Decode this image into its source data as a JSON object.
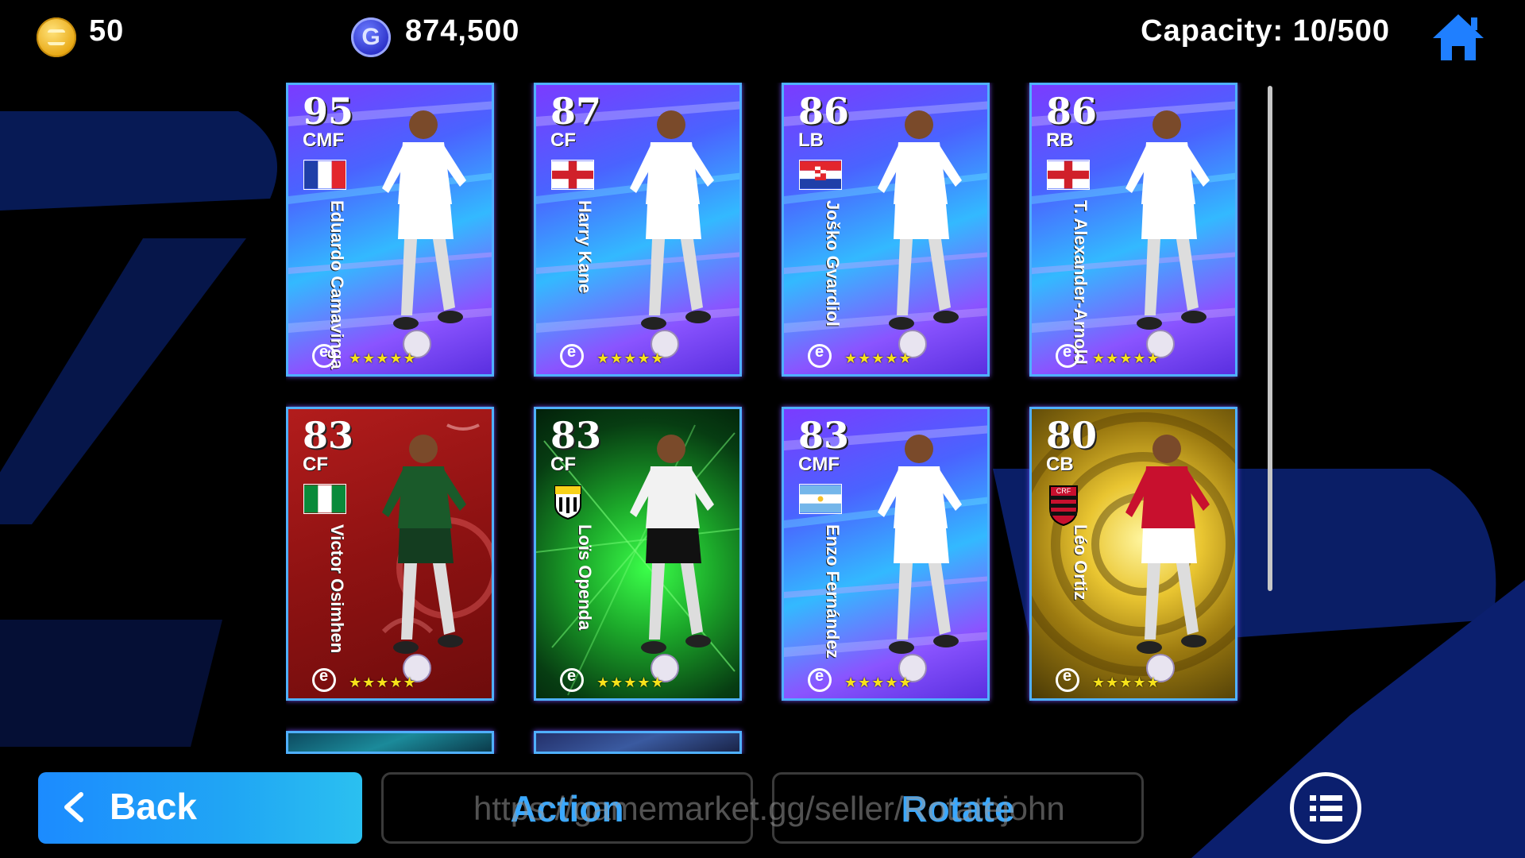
{
  "currency": {
    "coins": "50",
    "gp": "874,500",
    "gp_symbol": "G"
  },
  "capacity": "Capacity: 10/500",
  "cards": [
    {
      "rating": "95",
      "position": "CMF",
      "name": "Eduardo Camavinga",
      "flag": "france",
      "style": "blue",
      "stars": "★★★★★"
    },
    {
      "rating": "87",
      "position": "CF",
      "name": "Harry Kane",
      "flag": "england",
      "style": "blue",
      "stars": "★★★★★"
    },
    {
      "rating": "86",
      "position": "LB",
      "name": "Joško Gvardiol",
      "flag": "croatia",
      "style": "blue",
      "stars": "★★★★★"
    },
    {
      "rating": "86",
      "position": "RB",
      "name": "T. Alexander-Arnold",
      "flag": "england",
      "style": "blue",
      "stars": "★★★★★"
    },
    {
      "rating": "83",
      "position": "CF",
      "name": "Victor Osimhen",
      "flag": "nigeria",
      "style": "red",
      "stars": "★★★★★"
    },
    {
      "rating": "83",
      "position": "CF",
      "name": "Loïs Openda",
      "flag": "club-yellow-black",
      "style": "green",
      "stars": "★★★★★"
    },
    {
      "rating": "83",
      "position": "CMF",
      "name": "Enzo Fernández",
      "flag": "argentina",
      "style": "blue",
      "stars": "★★★★★"
    },
    {
      "rating": "80",
      "position": "CB",
      "name": "Léo Ortiz",
      "flag": "flamengo-crest",
      "style": "gold",
      "stars": "★★★★★"
    }
  ],
  "buttons": {
    "back": "Back",
    "action": "Action",
    "rotate": "Rotate"
  },
  "watermark": "https://gamemarket.gg/seller/Rotatejohn",
  "icons": {
    "coin": "coin-icon",
    "gp": "gp-icon",
    "home": "home-icon",
    "back": "chevron-left-icon",
    "menu": "list-menu-icon"
  },
  "colors": {
    "accent_blue": "#1c8bff",
    "action_text": "#3aa8ff",
    "home_blue": "#1f7fff",
    "star_yellow": "#f7e21a"
  }
}
